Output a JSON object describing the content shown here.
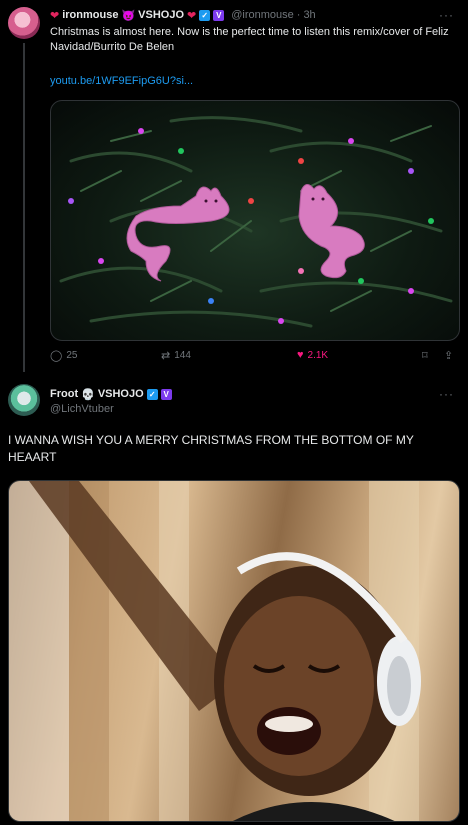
{
  "tweet1": {
    "name_part1": "ironmouse",
    "name_part2": "VSHOJO",
    "handle": "@ironmouse",
    "separator": "·",
    "time": "3h",
    "more": "···",
    "text": "Christmas is almost here. Now is the perfect time to listen this remix/cover of Feliz Navidad/Burrito De Belen",
    "link": "youtu.be/1WF9EFipG6U?si...",
    "actions": {
      "replies": "25",
      "reposts": "144",
      "likes": "2.1K"
    },
    "icons": [
      "heart-icon",
      "devil-icon",
      "verified-icon",
      "vtuber-badge-icon",
      "reply-icon",
      "repost-icon",
      "like-icon",
      "bookmark-icon",
      "share-icon"
    ]
  },
  "tweet2": {
    "name_part1": "Froot",
    "name_part2": "VSHOJO",
    "handle": "@LichVtuber",
    "more": "···",
    "text": "I WANNA WISH YOU A MERRY CHRISTMAS FROM THE BOTTOM OF MY HEAART",
    "icons": [
      "skull-icon",
      "verified-icon",
      "vtuber-badge-icon"
    ]
  },
  "colors": {
    "accent": "#1d9bf0",
    "like": "#f91880",
    "muted": "#71767b",
    "badge_purple": "#7c3aed"
  }
}
